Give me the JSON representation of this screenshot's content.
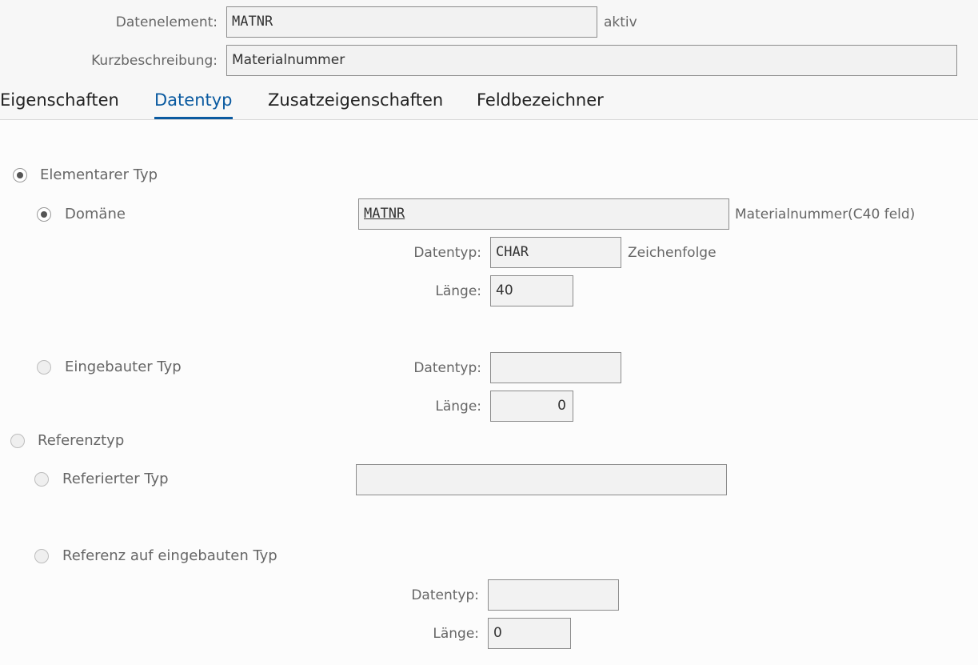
{
  "header": {
    "data_element_label": "Datenelement:",
    "data_element_value": "MATNR",
    "status": "aktiv",
    "short_desc_label": "Kurzbeschreibung:",
    "short_desc_value": "Materialnummer"
  },
  "tabs": [
    {
      "label": "Eigenschaften",
      "active": false
    },
    {
      "label": "Datentyp",
      "active": true
    },
    {
      "label": "Zusatzeigenschaften",
      "active": false
    },
    {
      "label": "Feldbezeichner",
      "active": false
    }
  ],
  "elementary": {
    "label": "Elementarer Typ",
    "selected": true,
    "domain": {
      "label": "Domäne",
      "selected": true,
      "value": "MATNR",
      "description": "Materialnummer(C40 feld)",
      "datatype_label": "Datentyp:",
      "datatype_value": "CHAR",
      "datatype_desc": "Zeichenfolge",
      "length_label": "Länge:",
      "length_value": "40"
    },
    "builtin": {
      "label": "Eingebauter Typ",
      "selected": false,
      "datatype_label": "Datentyp:",
      "datatype_value": "",
      "length_label": "Länge:",
      "length_value": "0"
    }
  },
  "reference": {
    "label": "Referenztyp",
    "selected": false,
    "referenced": {
      "label": "Referierter Typ",
      "selected": false,
      "value": ""
    },
    "builtin_ref": {
      "label": "Referenz auf eingebauten Typ",
      "selected": false,
      "datatype_label": "Datentyp:",
      "datatype_value": "",
      "length_label": "Länge:",
      "length_value": "0"
    }
  }
}
